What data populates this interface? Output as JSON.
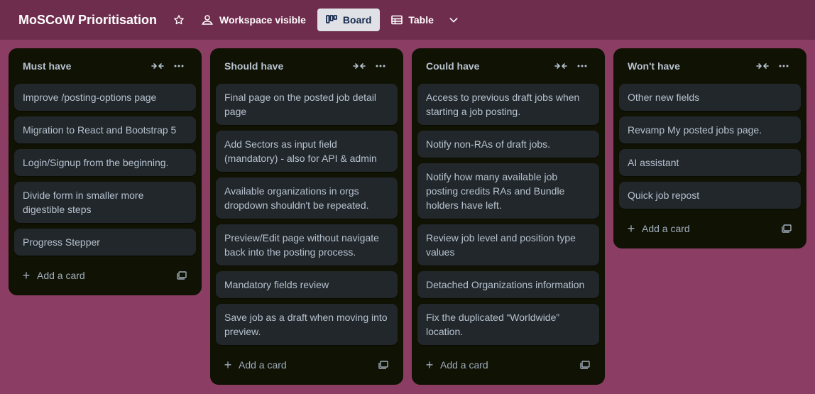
{
  "header": {
    "board_title": "MoSCoW Prioritisation",
    "visibility_label": "Workspace visible",
    "views": [
      {
        "label": "Board",
        "active": true
      },
      {
        "label": "Table",
        "active": false
      }
    ]
  },
  "lists": [
    {
      "title": "Must have",
      "cards": [
        "Improve /posting-options page",
        "Migration to React and Bootstrap 5",
        "Login/Signup from the beginning.",
        "Divide form in smaller more digestible steps",
        "Progress Stepper"
      ],
      "add_card_label": "Add a card"
    },
    {
      "title": "Should have",
      "cards": [
        "Final page on the posted job detail page",
        "Add Sectors as input field (mandatory) - also for API & admin",
        "Available organizations in orgs dropdown shouldn't be repeated.",
        "Preview/Edit page without navigate back into the posting process.",
        "Mandatory fields review",
        "Save job as a draft when moving into preview."
      ],
      "add_card_label": "Add a card"
    },
    {
      "title": "Could have",
      "cards": [
        "Access to previous draft jobs when starting a job posting.",
        "Notify non-RAs of draft jobs.",
        "Notify how many available job posting credits RAs and Bundle holders have left.",
        "Review job level and position type values",
        "Detached Organizations information",
        "Fix the duplicated “Worldwide” location."
      ],
      "add_card_label": "Add a card"
    },
    {
      "title": "Won't have",
      "cards": [
        "Other new fields",
        "Revamp My posted jobs page.",
        "AI assistant",
        "Quick job repost"
      ],
      "add_card_label": "Add a card"
    }
  ],
  "colors": {
    "background": "#8c3d63",
    "header": "#6f2d4e",
    "list": "#101204",
    "card": "#22272b",
    "text": "#b6c2cf"
  }
}
